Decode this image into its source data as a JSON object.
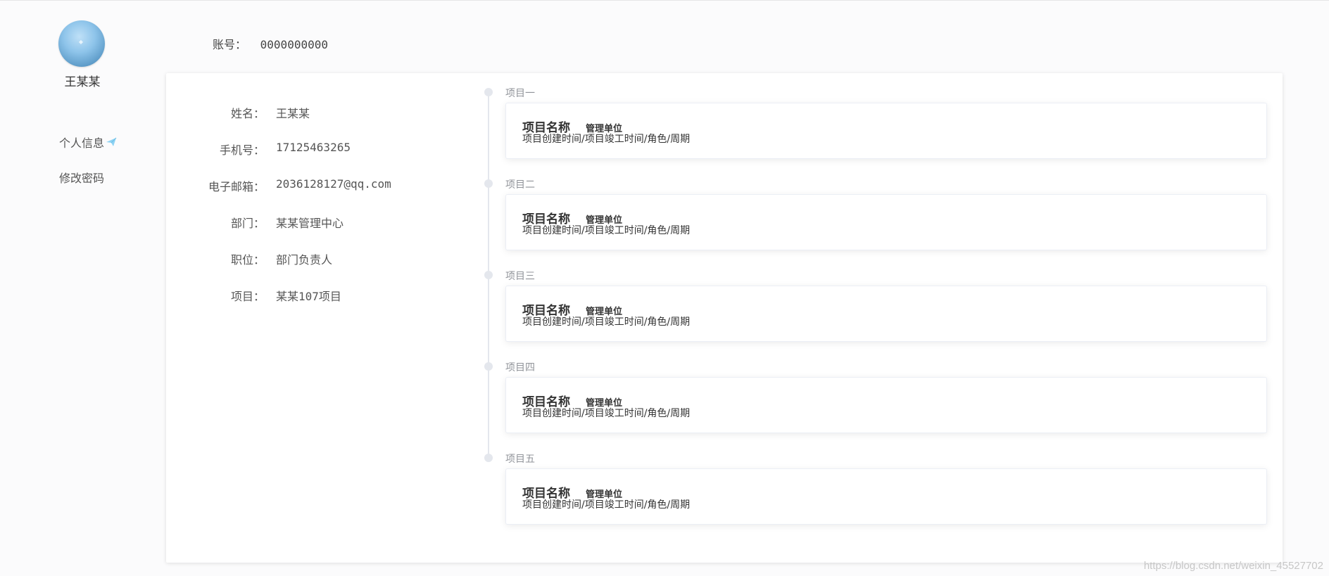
{
  "sidebar": {
    "username": "王某某",
    "menu": [
      {
        "label": "个人信息"
      },
      {
        "label": "修改密码"
      }
    ]
  },
  "account": {
    "label": "账号：",
    "value": "0000000000"
  },
  "profile": {
    "fields": [
      {
        "label": "姓名：",
        "value": "王某某"
      },
      {
        "label": "手机号：",
        "value": "17125463265"
      },
      {
        "label": "电子邮箱：",
        "value": "2036128127@qq.com"
      },
      {
        "label": "部门：",
        "value": "某某管理中心"
      },
      {
        "label": "职位：",
        "value": "部门负责人"
      },
      {
        "label": "项目：",
        "value": "某某107项目"
      }
    ]
  },
  "timeline": [
    {
      "title": "项目一",
      "name": "项目名称",
      "unit": "管理单位",
      "meta": "项目创建时间/项目竣工时间/角色/周期"
    },
    {
      "title": "项目二",
      "name": "项目名称",
      "unit": "管理单位",
      "meta": "项目创建时间/项目竣工时间/角色/周期"
    },
    {
      "title": "项目三",
      "name": "项目名称",
      "unit": "管理单位",
      "meta": "项目创建时间/项目竣工时间/角色/周期"
    },
    {
      "title": "项目四",
      "name": "项目名称",
      "unit": "管理单位",
      "meta": "项目创建时间/项目竣工时间/角色/周期"
    },
    {
      "title": "项目五",
      "name": "项目名称",
      "unit": "管理单位",
      "meta": "项目创建时间/项目竣工时间/角色/周期"
    }
  ],
  "watermark": "https://blog.csdn.net/weixin_45527702",
  "colors": {
    "accent": "#8fd3f4",
    "timeline": "#e4e7ed",
    "muted": "#909399"
  }
}
